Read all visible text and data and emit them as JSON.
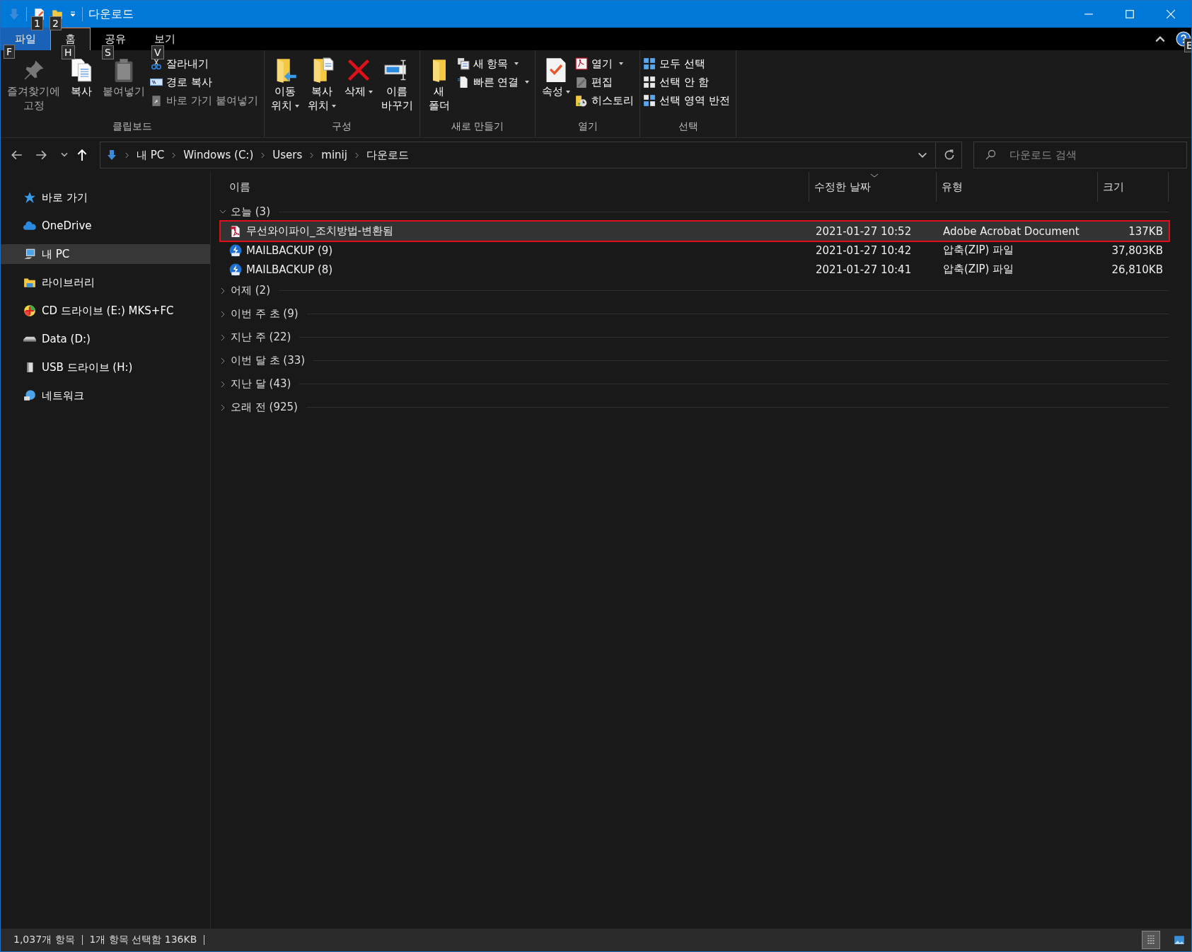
{
  "window": {
    "title": "다운로드"
  },
  "quick_access_keytips": [
    "1",
    "2"
  ],
  "ribbon_tabs": [
    {
      "label": "파일",
      "kind": "file",
      "selected": false,
      "keytip": "F"
    },
    {
      "label": "홈",
      "kind": "tab",
      "selected": true,
      "keytip": "H"
    },
    {
      "label": "공유",
      "kind": "tab",
      "selected": false,
      "keytip": "S"
    },
    {
      "label": "보기",
      "kind": "tab",
      "selected": false,
      "keytip": "V"
    }
  ],
  "help_keytip": "E",
  "ribbon_groups": [
    {
      "label": "클립보드",
      "items": [
        {
          "label": "즐겨찾기에\n고정",
          "kind": "large",
          "disabled": true,
          "dropdown": false
        },
        {
          "label": "복사",
          "kind": "large",
          "disabled": false,
          "dropdown": false
        },
        {
          "label": "붙여넣기",
          "kind": "large",
          "disabled": true,
          "dropdown": false
        },
        {
          "label": "잘라내기",
          "kind": "small",
          "disabled": false,
          "dropdown": false
        },
        {
          "label": "경로 복사",
          "kind": "small",
          "disabled": false,
          "dropdown": false
        },
        {
          "label": "바로 가기 붙여넣기",
          "kind": "small",
          "disabled": true,
          "dropdown": false
        }
      ]
    },
    {
      "label": "구성",
      "items": [
        {
          "label": "이동\n위치",
          "kind": "large",
          "disabled": false,
          "dropdown": true
        },
        {
          "label": "복사\n위치",
          "kind": "large",
          "disabled": false,
          "dropdown": true
        },
        {
          "label": "삭제",
          "kind": "large",
          "disabled": false,
          "dropdown": true
        },
        {
          "label": "이름\n바꾸기",
          "kind": "large",
          "disabled": false,
          "dropdown": false
        }
      ]
    },
    {
      "label": "새로 만들기",
      "items": [
        {
          "label": "새\n폴더",
          "kind": "large",
          "disabled": false,
          "dropdown": false
        },
        {
          "label": "새 항목",
          "kind": "small",
          "disabled": false,
          "dropdown": true
        },
        {
          "label": "빠른 연결",
          "kind": "small",
          "disabled": false,
          "dropdown": true
        }
      ]
    },
    {
      "label": "열기",
      "items": [
        {
          "label": "속성",
          "kind": "large",
          "disabled": false,
          "dropdown": true
        },
        {
          "label": "열기",
          "kind": "small",
          "disabled": false,
          "dropdown": true
        },
        {
          "label": "편집",
          "kind": "small",
          "disabled": false,
          "dropdown": false
        },
        {
          "label": "히스토리",
          "kind": "small",
          "disabled": false,
          "dropdown": false
        }
      ]
    },
    {
      "label": "선택",
      "items": [
        {
          "label": "모두 선택",
          "kind": "small",
          "disabled": false,
          "dropdown": false
        },
        {
          "label": "선택 안 함",
          "kind": "small",
          "disabled": false,
          "dropdown": false
        },
        {
          "label": "선택 영역 반전",
          "kind": "small",
          "disabled": false,
          "dropdown": false
        }
      ]
    }
  ],
  "address_bar": {
    "path": [
      "내 PC",
      "Windows (C:)",
      "Users",
      "minij",
      "다운로드"
    ]
  },
  "search": {
    "placeholder": "다운로드 검색"
  },
  "sidebar": {
    "items": [
      {
        "label": "바로 가기",
        "selected": false
      },
      {
        "label": "OneDrive",
        "selected": false
      },
      {
        "label": "내 PC",
        "selected": true
      },
      {
        "label": "라이브러리",
        "selected": false
      },
      {
        "label": "CD 드라이브 (E:) MKS+FC",
        "selected": false
      },
      {
        "label": "Data (D:)",
        "selected": false
      },
      {
        "label": "USB 드라이브 (H:)",
        "selected": false
      },
      {
        "label": "네트워크",
        "selected": false
      }
    ]
  },
  "table": {
    "columns": [
      {
        "label": "이름",
        "sorted": false
      },
      {
        "label": "수정한 날짜",
        "sorted": true
      },
      {
        "label": "유형",
        "sorted": false
      },
      {
        "label": "크기",
        "sorted": false
      }
    ],
    "groups": [
      {
        "label": "오늘 (3)",
        "expanded": true,
        "rows": [
          {
            "kind": "pdf",
            "name": "무선와이파이_조치방법-변환됨",
            "date": "2021-01-27 10:52",
            "type": "Adobe Acrobat Document",
            "size": "137KB",
            "selected": true,
            "highlighted": true
          },
          {
            "kind": "zip",
            "name": "MAILBACKUP (9)",
            "date": "2021-01-27 10:42",
            "type": "압축(ZIP) 파일",
            "size": "37,803KB",
            "selected": false,
            "highlighted": false
          },
          {
            "kind": "zip",
            "name": "MAILBACKUP (8)",
            "date": "2021-01-27 10:41",
            "type": "압축(ZIP) 파일",
            "size": "26,810KB",
            "selected": false,
            "highlighted": false
          }
        ]
      },
      {
        "label": "어제 (2)",
        "expanded": false
      },
      {
        "label": "이번 주 초 (9)",
        "expanded": false
      },
      {
        "label": "지난 주 (22)",
        "expanded": false
      },
      {
        "label": "이번 달 초 (33)",
        "expanded": false
      },
      {
        "label": "지난 달 (43)",
        "expanded": false
      },
      {
        "label": "오래 전 (925)",
        "expanded": false
      }
    ]
  },
  "status_bar": {
    "item_count": "1,037개 항목",
    "selection": "1개 항목 선택함 136KB",
    "views": [
      {
        "kind": "details",
        "selected": true
      },
      {
        "kind": "large-icons",
        "selected": false
      }
    ]
  }
}
